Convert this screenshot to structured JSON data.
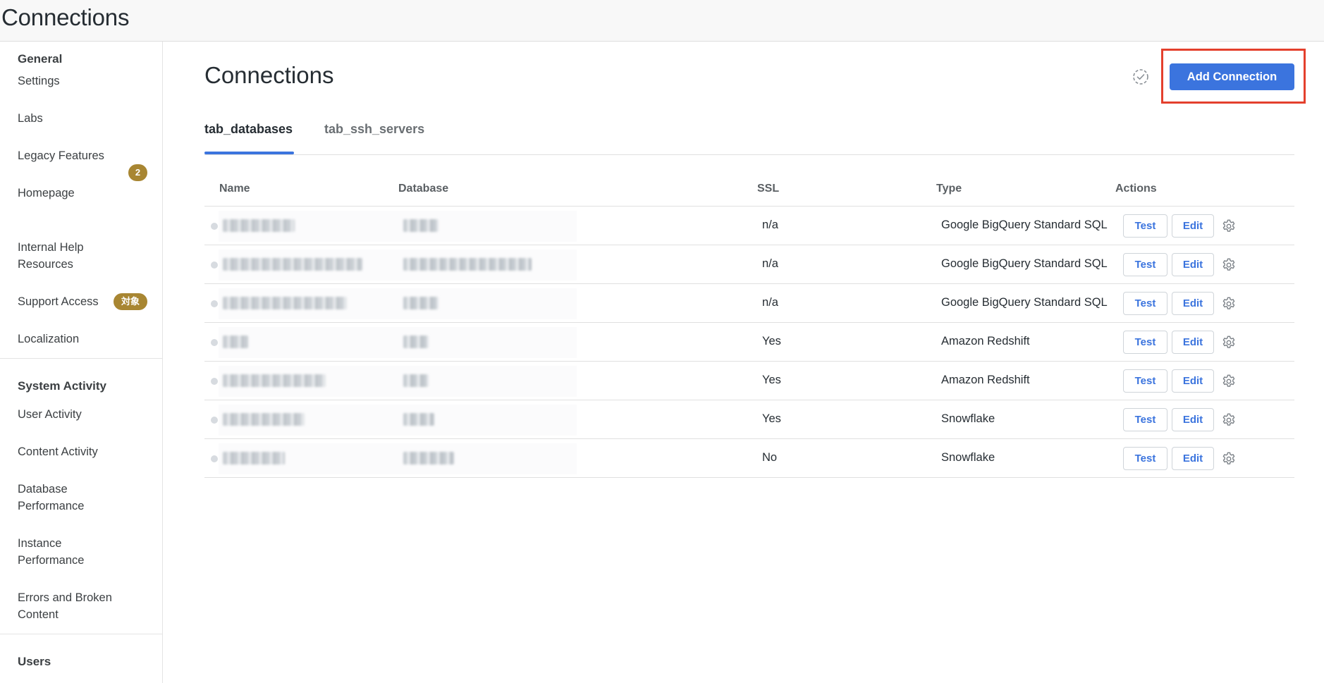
{
  "header": {
    "app_title": "Connections"
  },
  "sidebar": {
    "sections": [
      {
        "label": "General",
        "items": [
          {
            "label": "Settings"
          },
          {
            "label": "Labs"
          },
          {
            "label": "Legacy Features",
            "badge": "2"
          },
          {
            "label": "Homepage"
          },
          {
            "label": "Internal Help Resources"
          },
          {
            "label": "Support Access",
            "badge": "対象"
          },
          {
            "label": "Localization"
          }
        ]
      },
      {
        "label": "System Activity",
        "items": [
          {
            "label": "User Activity"
          },
          {
            "label": "Content Activity"
          },
          {
            "label": "Database Performance"
          },
          {
            "label": "Instance Performance"
          },
          {
            "label": "Errors and Broken Content"
          }
        ]
      },
      {
        "label": "Users",
        "items": []
      }
    ]
  },
  "main": {
    "title": "Connections",
    "add_button_label": "Add Connection",
    "tabs": [
      {
        "label": "tab_databases",
        "active": true
      },
      {
        "label": "tab_ssh_servers",
        "active": false
      }
    ],
    "table": {
      "columns": [
        "Name",
        "Database",
        "SSL",
        "Type",
        "Actions"
      ],
      "action_labels": {
        "test": "Test",
        "edit": "Edit"
      },
      "rows": [
        {
          "ssl": "n/a",
          "type": "Google BigQuery Standard SQL"
        },
        {
          "ssl": "n/a",
          "type": "Google BigQuery Standard SQL"
        },
        {
          "ssl": "n/a",
          "type": "Google BigQuery Standard SQL"
        },
        {
          "ssl": "Yes",
          "type": "Amazon Redshift"
        },
        {
          "ssl": "Yes",
          "type": "Amazon Redshift"
        },
        {
          "ssl": "Yes",
          "type": "Snowflake"
        },
        {
          "ssl": "No",
          "type": "Snowflake"
        }
      ]
    }
  },
  "colors": {
    "accent": "#3b74de",
    "badge": "#a88632",
    "highlight": "#e4402d"
  },
  "icons": {
    "status": "check-circle-dashed-icon",
    "row_settings": "gear-icon"
  }
}
